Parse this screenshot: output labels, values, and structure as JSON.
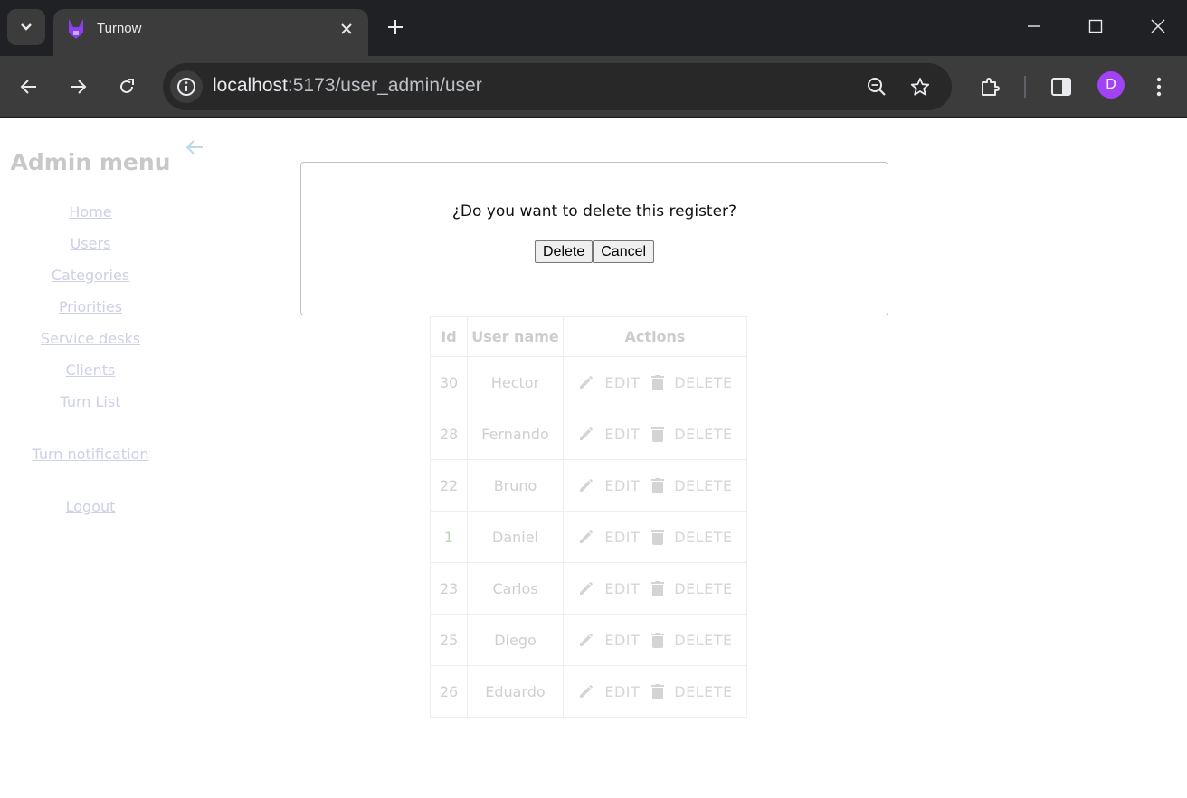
{
  "browser": {
    "tab_title": "Turnow",
    "url_host": "localhost",
    "url_path": ":5173/user_admin/user",
    "profile_initial": "D"
  },
  "sidebar": {
    "title": "Admin menu",
    "items": [
      {
        "label": "Home"
      },
      {
        "label": "Users"
      },
      {
        "label": "Categories"
      },
      {
        "label": "Priorities"
      },
      {
        "label": "Service desks"
      },
      {
        "label": "Clients"
      },
      {
        "label": "Turn List"
      }
    ],
    "notification_label": "Turn notification",
    "logout_label": "Logout"
  },
  "modal": {
    "message": "¿Do you want to delete this register?",
    "delete_label": "Delete",
    "cancel_label": "Cancel"
  },
  "table": {
    "headers": [
      "Id",
      "User name",
      "Actions"
    ],
    "edit_label": "EDIT",
    "delete_label": "DELETE",
    "rows": [
      {
        "id": "30",
        "name": "Hector"
      },
      {
        "id": "28",
        "name": "Fernando"
      },
      {
        "id": "22",
        "name": "Bruno"
      },
      {
        "id": "1",
        "name": "Daniel"
      },
      {
        "id": "23",
        "name": "Carlos"
      },
      {
        "id": "25",
        "name": "Diego"
      },
      {
        "id": "26",
        "name": "Eduardo"
      }
    ]
  },
  "colors": {
    "chrome_dark": "#202124",
    "toolbar": "#3c3c3c",
    "avatar": "#a142f4",
    "back_arrow": "#bfd9ec",
    "link": "#cdd0e6"
  }
}
